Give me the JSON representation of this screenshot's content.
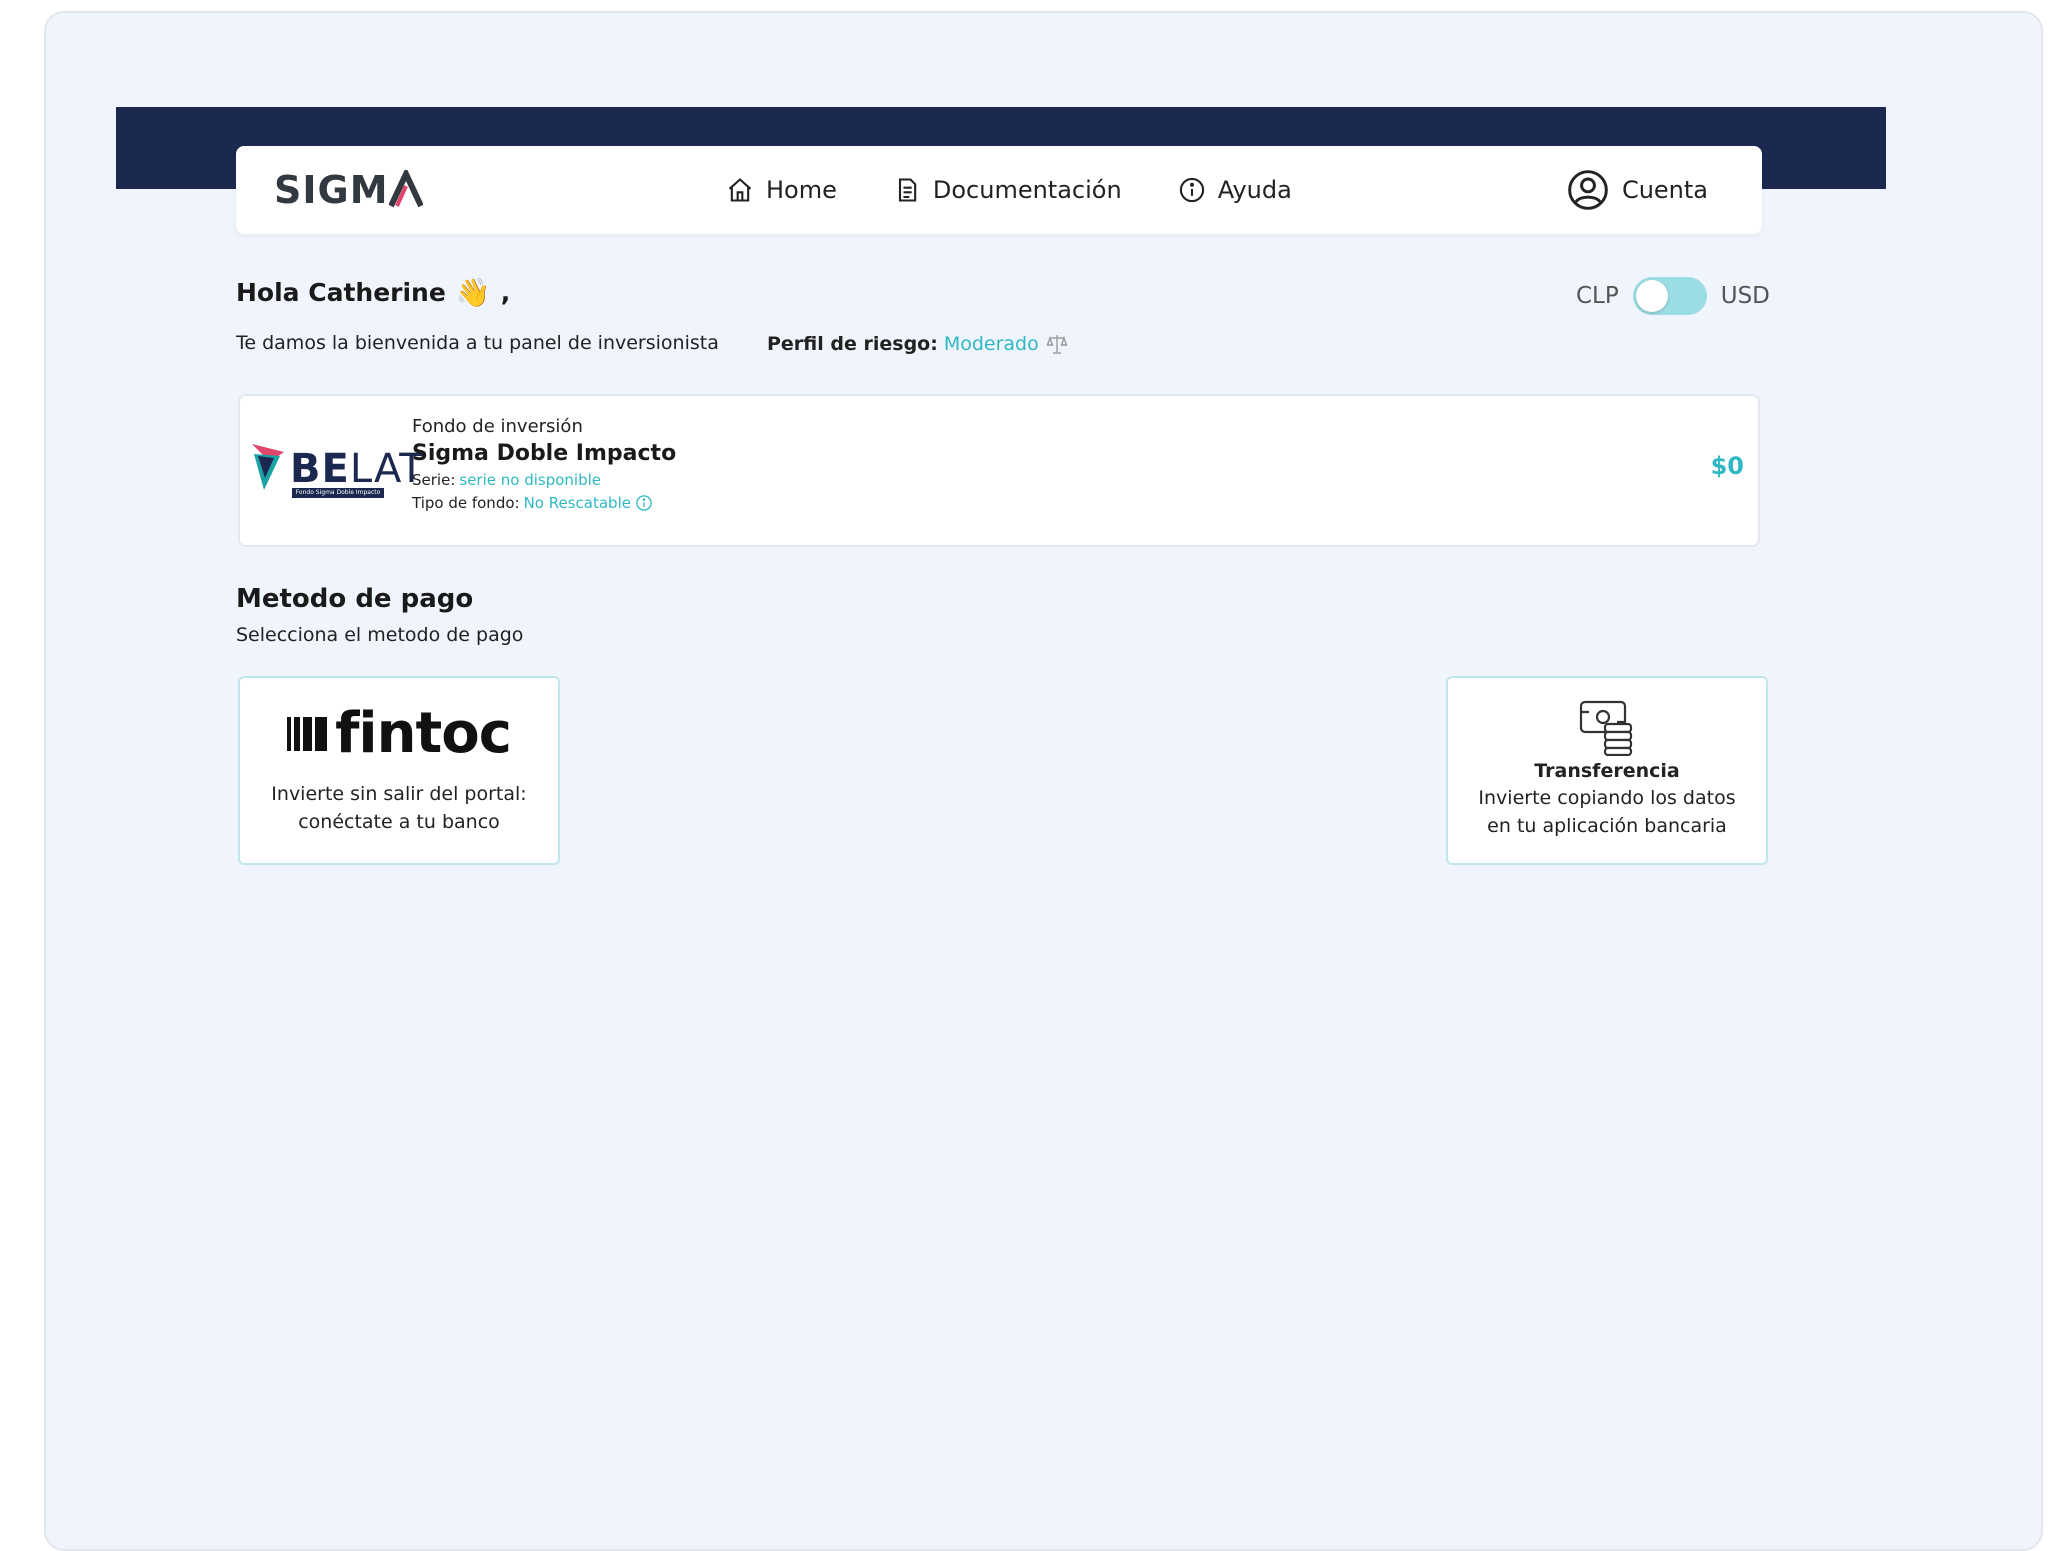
{
  "brand": {
    "logo_text": "SIGM",
    "accent": "#2fb8c4",
    "navy": "#1b2850",
    "logo_accent": "#e0456b"
  },
  "nav": {
    "home_label": "Home",
    "docs_label": "Documentación",
    "help_label": "Ayuda",
    "account_label": "Cuenta"
  },
  "greeting": {
    "title": "Hola Catherine",
    "emoji": "👋",
    "suffix": ",",
    "welcome": "Te damos la bienvenida a tu panel de inversionista",
    "risk_label": "Perfil de riesgo:",
    "risk_value": "Moderado"
  },
  "currency": {
    "left": "CLP",
    "right": "USD",
    "selected": "CLP"
  },
  "fund": {
    "logo_text_bold": "BE",
    "logo_text_thin": "LAT",
    "logo_sub": "Fondo Sigma Doble Impacto",
    "kind": "Fondo de inversión",
    "name": "Sigma Doble Impacto",
    "series_label": "Serie:",
    "series_value": "serie no disponible",
    "type_label": "Tipo de fondo:",
    "type_value": "No Rescatable",
    "amount": "$0"
  },
  "payment": {
    "title": "Metodo de pago",
    "subtitle": "Selecciona el metodo de pago",
    "fintoc": {
      "logo_text": "fintoc",
      "desc_line1": "Invierte sin salir del portal:",
      "desc_line2": "conéctate a tu banco"
    },
    "transfer": {
      "title": "Transferencia",
      "desc_line1": "Invierte copiando los datos",
      "desc_line2": "en tu aplicación bancaria"
    }
  }
}
